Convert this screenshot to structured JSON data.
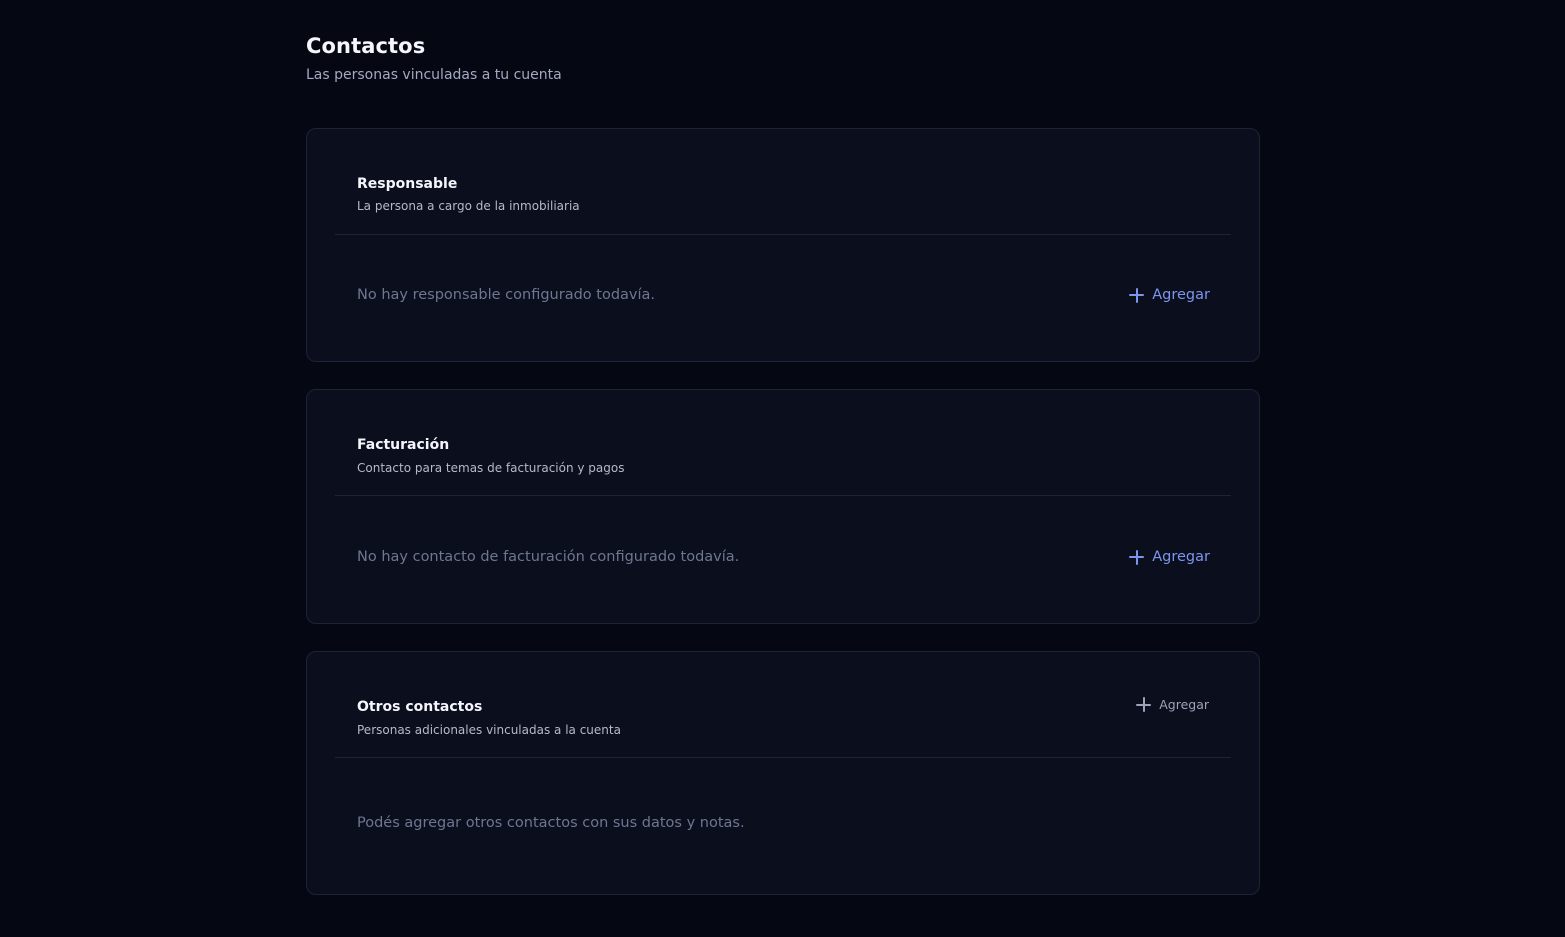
{
  "header": {
    "title": "Contactos",
    "subtitle": "Las personas vinculadas a tu cuenta"
  },
  "cards": {
    "responsable": {
      "title": "Responsable",
      "description": "La persona a cargo de la inmobiliaria",
      "empty_text": "No hay responsable configurado todavía.",
      "add_label": "Agregar"
    },
    "facturacion": {
      "title": "Facturación",
      "description": "Contacto para temas de facturación y pagos",
      "empty_text": "No hay contacto de facturación configurado todavía.",
      "add_label": "Agregar"
    },
    "otros": {
      "title": "Otros contactos",
      "description": "Personas adicionales vinculadas a la cuenta",
      "empty_text": "Podés agregar otros contactos con sus datos y notas.",
      "add_label": "Agregar"
    }
  },
  "icons": {
    "add": "plus-icon"
  },
  "colors": {
    "background": "#050713",
    "card": "#0a0e1d",
    "accent": "#7d95ec",
    "muted_text": "#6f7690"
  }
}
